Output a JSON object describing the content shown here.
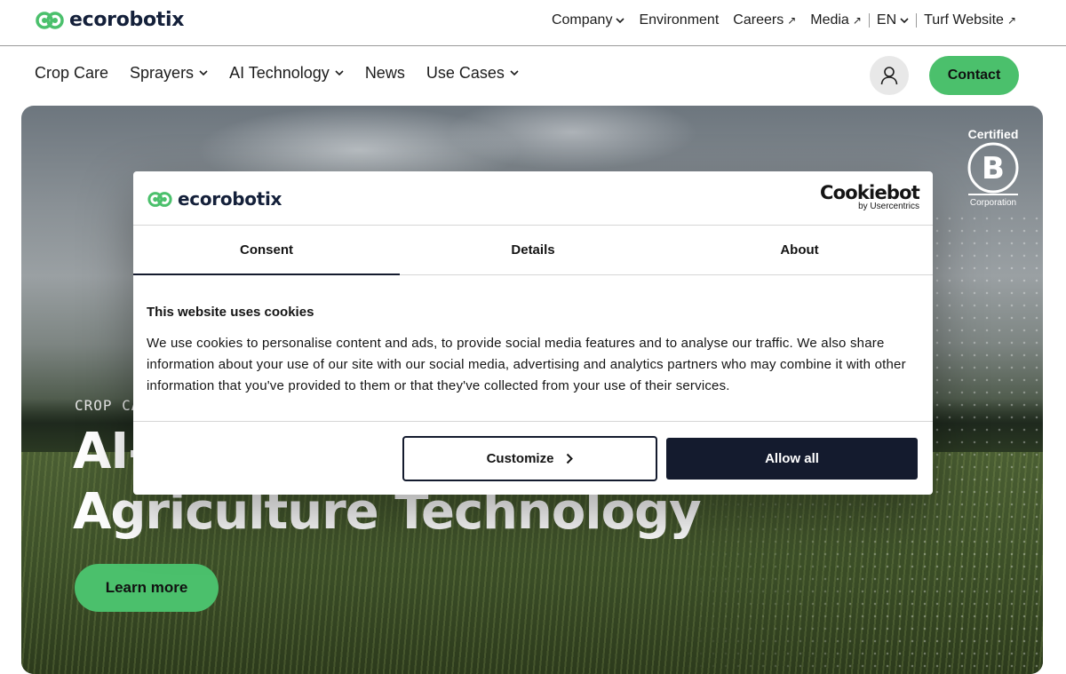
{
  "brand": {
    "name": "ecorobotix",
    "accent": "#4bc06c",
    "navy": "#141b2e"
  },
  "topnav": {
    "items": [
      {
        "label": "Company",
        "icon": "chevron-down-icon"
      },
      {
        "label": "Environment"
      },
      {
        "label": "Careers",
        "icon": "external-arrow-icon"
      },
      {
        "label": "Media",
        "icon": "external-arrow-icon"
      },
      {
        "label": "EN",
        "icon": "chevron-down-icon"
      },
      {
        "label": "Turf Website",
        "icon": "external-arrow-icon"
      }
    ]
  },
  "mainnav": {
    "items": [
      {
        "label": "Crop Care"
      },
      {
        "label": "Sprayers",
        "icon": "chevron-down-icon"
      },
      {
        "label": "AI Technology",
        "icon": "chevron-down-icon"
      },
      {
        "label": "News"
      },
      {
        "label": "Use Cases",
        "icon": "chevron-down-icon"
      }
    ],
    "contact_label": "Contact",
    "user_icon": "user-icon"
  },
  "hero": {
    "eyebrow": "CROP CA",
    "title_line1": "AI-",
    "title_line2": "Agriculture Technology",
    "cta_label": "Learn more",
    "badge": {
      "top": "Certified",
      "letter": "B",
      "bottom": "Corporation"
    }
  },
  "cookie_dialog": {
    "logo": "ecorobotix",
    "provider": {
      "name": "Cookiebot",
      "sub": "by Usercentrics"
    },
    "tabs": [
      {
        "label": "Consent",
        "active": true
      },
      {
        "label": "Details",
        "active": false
      },
      {
        "label": "About",
        "active": false
      }
    ],
    "heading": "This website uses cookies",
    "body": "We use cookies to personalise content and ads, to provide social media features and to analyse our traffic. We also share information about your use of our site with our social media, advertising and analytics partners who may combine it with other information that you've provided to them or that they've collected from your use of their services.",
    "customize_label": "Customize",
    "allow_label": "Allow all"
  }
}
